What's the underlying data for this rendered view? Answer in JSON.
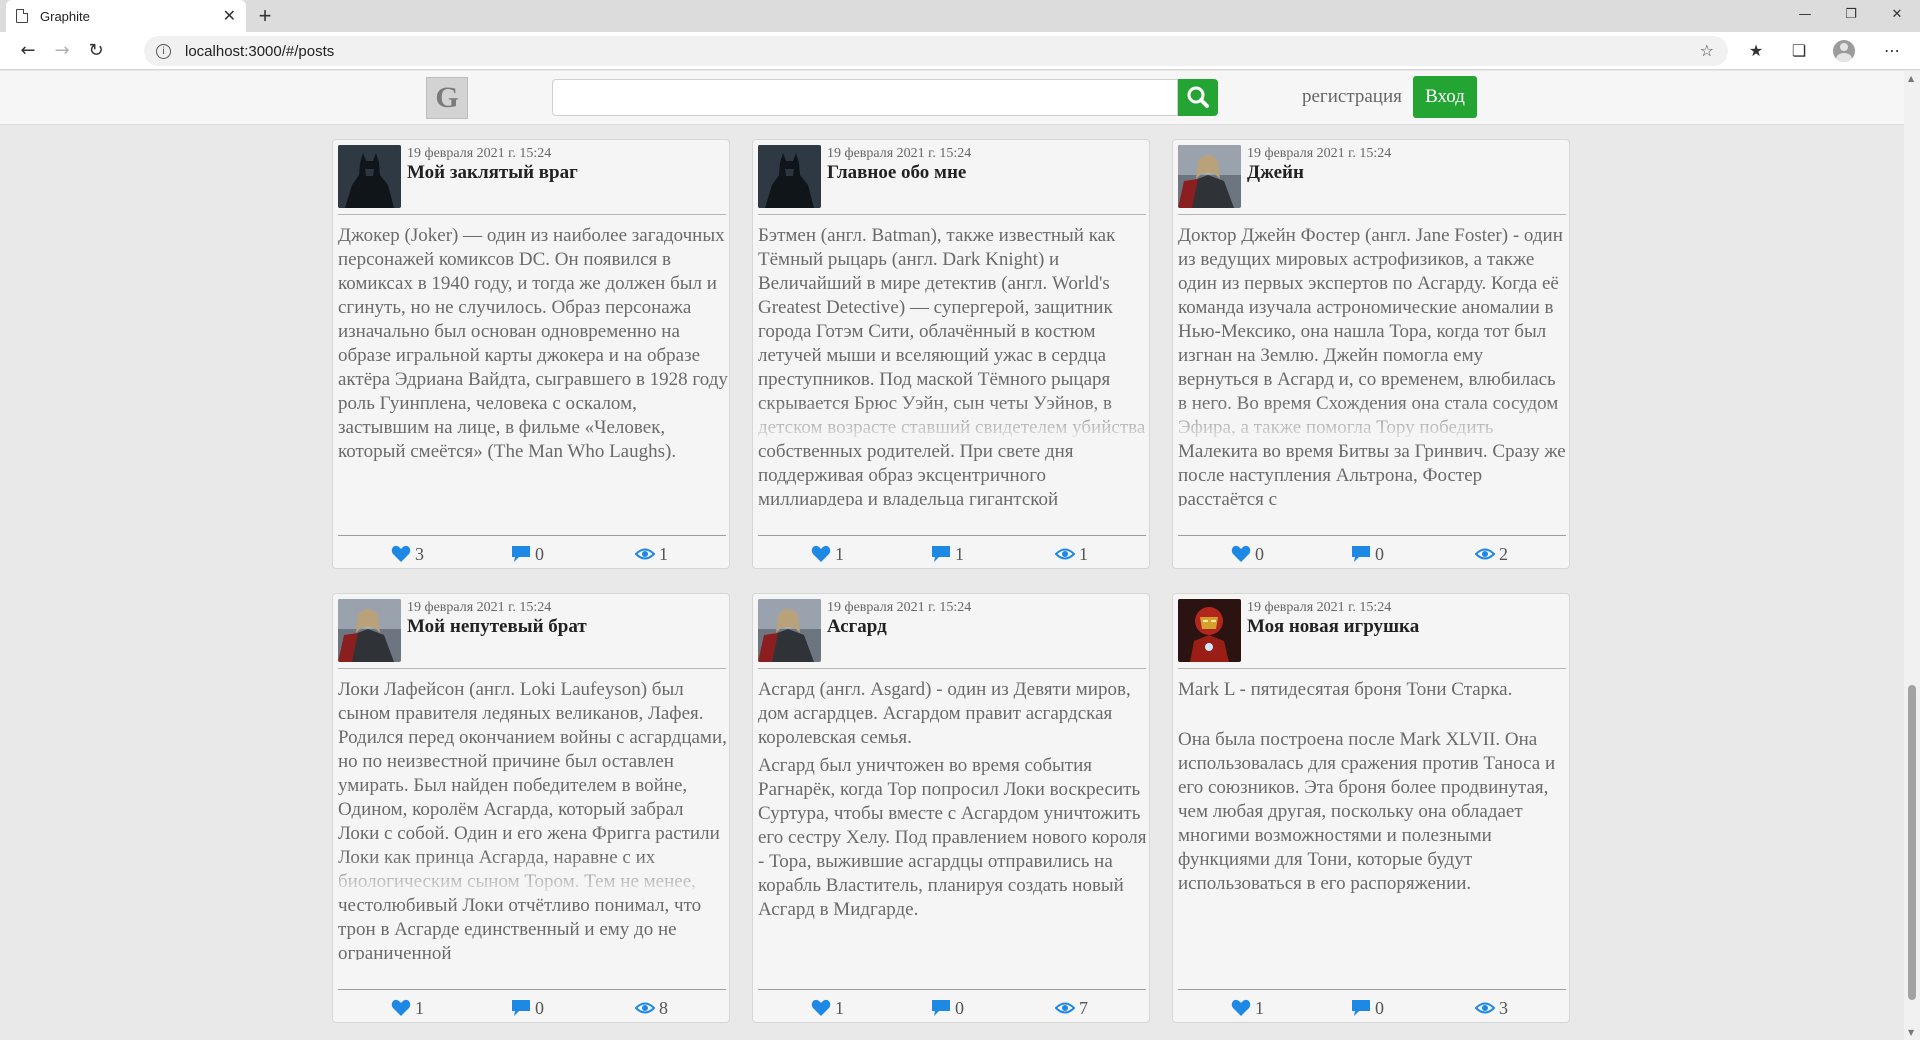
{
  "browser": {
    "tab_title": "Graphite",
    "url": "localhost:3000/#/posts",
    "tab_close": "✕",
    "new_tab": "+"
  },
  "site": {
    "logo": "G",
    "register_label": "регистрация",
    "login_label": "Вход",
    "accent_color": "#23a433",
    "icon_color": "#1e88e5"
  },
  "posts": [
    {
      "date": "19 февраля 2021 г. 15:24",
      "title": "Мой заклятый враг",
      "image": "batman-thumbnail",
      "paragraphs": [
        "Джокер (Joker) — один из наиболее загадочных персонажей комиксов DC. Он появился в комиксах в 1940 году, и тогда же должен был и сгинуть, но не случилось. Образ персонажа изначально был основан одновременно на образе игральной карты джокера и на образе актёра Эдриана Вайдта, сыгравшего в 1928 году роль Гуинплена, человека с оскалом, застывшим на лице, в фильме «Человек, который смеётся» (The Man Who Laughs)."
      ],
      "likes": "3",
      "comments": "0",
      "views": "1"
    },
    {
      "date": "19 февраля 2021 г. 15:24",
      "title": "Главное обо мне",
      "image": "batman-thumbnail",
      "paragraphs": [
        "Бэтмен (англ. Batman), также известный как Тёмный рыцарь (англ. Dark Knight) и Величайший в мире детектив (англ. World's Greatest Detective) — супергерой, защитник города Готэм Сити, облачённый в костюм летучей мыши и вселяющий ужас в сердца преступников. Под маской Тёмного рыцаря скрывается Брюс Уэйн, сын четы Уэйнов, в детском возрасте ставший свидетелем убийства собственных родителей. При свете дня поддерживая образ эксцентричного миллиардера и владельца гигантской"
      ],
      "likes": "1",
      "comments": "1",
      "views": "1"
    },
    {
      "date": "19 февраля 2021 г. 15:24",
      "title": "Джейн",
      "image": "thor-thumbnail",
      "paragraphs": [
        "Доктор Джейн Фостер (англ. Jane Foster) - один из ведущих мировых астрофизиков, а также один из первых экспертов по Асгарду. Когда её команда изучала астрономические аномалии в Нью-Мексико, она нашла Тора, когда тот был изгнан на Землю. Джейн помогла ему вернуться в Асгард и, со временем, влюбилась в него. Во время Схождения она стала сосудом Эфира, а также помогла Тору победить Малекита во время Битвы за Гринвич. Сразу же после наступления Альтрона, Фостер расстаётся с"
      ],
      "likes": "0",
      "comments": "0",
      "views": "2"
    },
    {
      "date": "19 февраля 2021 г. 15:24",
      "title": "Мой непутевый брат",
      "image": "thor-thumbnail",
      "paragraphs": [
        "Локи Лафейсон (англ. Loki Laufeyson) был сыном правителя ледяных великанов, Лафея. Родился перед окончанием войны с асгардцами, но по неизвестной причине был оставлен умирать. Был найден победителем в войне, Одином, королём Асгарда, который забрал Локи с собой. Один и его жена Фригга растили Локи как принца Асгарда, наравне с их биологическим сыном Тором. Тем не менее, честолюбивый Локи отчётливо понимал, что трон в Асгарде единственный и ему до не ограниченной"
      ],
      "likes": "1",
      "comments": "0",
      "views": "8"
    },
    {
      "date": "19 февраля 2021 г. 15:24",
      "title": "Асгард",
      "image": "thor-thumbnail",
      "paragraphs": [
        "Асгард (англ. Asgard) - один из Девяти миров, дом асгардцев. Асгардом правит асгардская королевская семья.",
        "Асгард был уничтожен во время события Рагнарёк, когда Тор попросил Локи воскресить Суртура, чтобы вместе с Асгардом уничтожить его сестру Хелу. Под правлением нового короля - Тора, выжившие асгардцы отправились на корабль Властитель, планируя создать новый Асгард в Мидгарде."
      ],
      "likes": "1",
      "comments": "0",
      "views": "7"
    },
    {
      "date": "19 февраля 2021 г. 15:24",
      "title": "Моя новая игрушка",
      "image": "ironman-thumbnail",
      "paragraphs": [
        "Mark L - пятидесятая броня Тони Старка.",
        "Она была построена после Mark XLVII. Она использовалась для сражения против Таноса и его союзников. Эта броня более продвинутая, чем любая другая, поскольку она обладает многими возможностями и полезными функциями для Тони, которые будут использоваться в его распоряжении."
      ],
      "likes": "1",
      "comments": "0",
      "views": "3"
    }
  ]
}
